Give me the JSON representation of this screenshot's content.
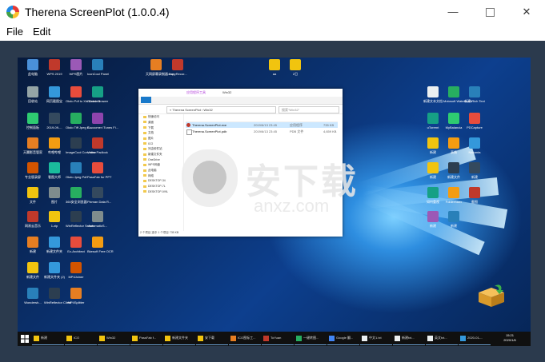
{
  "window": {
    "title": "Therena ScreenPlot (1.0.0.4)",
    "min_glyph": "—",
    "close_glyph": "✕"
  },
  "menu": {
    "file": "File",
    "edit": "Edit"
  },
  "desktop": {
    "icons": [
      {
        "label": "此电脑",
        "color": "#4a90d9"
      },
      {
        "label": "WPS 2019",
        "color": "#c0392b"
      },
      {
        "label": "WPS图片",
        "color": "#9b59b6"
      },
      {
        "label": "IconCool Panel",
        "color": "#2980b9"
      },
      {
        "label": "天网屏幕录制器.exe",
        "color": "#e67e22"
      },
      {
        "label": "CopyRecor...",
        "color": "#c0392b"
      },
      {
        "label": "aa",
        "color": "#f1c40f"
      },
      {
        "label": "2日",
        "color": "#f1c40f"
      },
      {
        "label": "回收站",
        "color": "#95a5a6"
      },
      {
        "label": "网页截图宝",
        "color": "#3498db"
      },
      {
        "label": "Okdo Pdf to Xls Convert",
        "color": "#e74c3c"
      },
      {
        "label": "Sketch Drawer",
        "color": "#16a085"
      },
      {
        "label": "控制面板",
        "color": "#2ecc71"
      },
      {
        "label": "2019-09-...",
        "color": "#34495e"
      },
      {
        "label": "Okdo Tiff Jpeg B...",
        "color": "#27ae60"
      },
      {
        "label": "Cococmer iTunes Fi...",
        "color": "#8e44ad"
      },
      {
        "label": "天翼影音管家",
        "color": "#e67e22"
      },
      {
        "label": "哔哩哔哩",
        "color": "#f39c12"
      },
      {
        "label": "ImageCool Converter",
        "color": "#2c3e50"
      },
      {
        "label": "Video Padlock",
        "color": "#c0392b"
      },
      {
        "label": "专业版录屏",
        "color": "#d35400"
      },
      {
        "label": "看图大师",
        "color": "#1abc9c"
      },
      {
        "label": "Okdo Jpeg Pdf",
        "color": "#2980b9"
      },
      {
        "label": "PassFab for PPT",
        "color": "#e74c3c"
      },
      {
        "label": "文件",
        "color": "#f1c40f"
      },
      {
        "label": "图片",
        "color": "#7f8c8d"
      },
      {
        "label": "360安全浏览器",
        "color": "#27ae60"
      },
      {
        "label": "Pixman Data R...",
        "color": "#34495e"
      },
      {
        "label": "网易云音乐",
        "color": "#c0392b"
      },
      {
        "label": "1.zip",
        "color": "#f1c40f"
      },
      {
        "label": "WinReflector Server",
        "color": "#2c3e50"
      },
      {
        "label": "AutomaticS...",
        "color": "#7f8c8d"
      },
      {
        "label": "新建",
        "color": "#e67e22"
      },
      {
        "label": "新建文件夹",
        "color": "#3498db"
      },
      {
        "label": "Ez-Architect",
        "color": "#e74c3c"
      },
      {
        "label": "Bkesoft Free OCR",
        "color": "#f39c12"
      },
      {
        "label": "新建文件",
        "color": "#f1c40f"
      },
      {
        "label": "新建文件夹 (2)",
        "color": "#3498db"
      },
      {
        "label": "MP4Joiner",
        "color": "#d35400"
      },
      {
        "label": "Wondersh...",
        "color": "#2980b9"
      },
      {
        "label": "WinReflector Client",
        "color": "#2c3e50"
      },
      {
        "label": "MP4Splitter",
        "color": "#e67e22"
      }
    ],
    "right_icons": [
      {
        "label": "新建文本文档",
        "color": "#ecf0f1"
      },
      {
        "label": "Motosoft Watermark",
        "color": "#27ae60"
      },
      {
        "label": "新建 Rich Text",
        "color": "#2980b9"
      },
      {
        "label": "uTorrent",
        "color": "#16a085"
      },
      {
        "label": "MyBalancia",
        "color": "#2ecc71"
      },
      {
        "label": "PDCapture",
        "color": "#e74c3c"
      },
      {
        "label": "新建",
        "color": "#f1c40f"
      },
      {
        "label": "表情",
        "color": "#f39c12"
      },
      {
        "label": "Nakanta",
        "color": "#3498db"
      },
      {
        "label": "新建",
        "color": "#f1c40f"
      },
      {
        "label": "新建文件",
        "color": "#2c3e50"
      },
      {
        "label": "新建",
        "color": "#34495e"
      },
      {
        "label": "如何重视",
        "color": "#16a085"
      },
      {
        "label": "FolderSizer",
        "color": "#f39c12"
      },
      {
        "label": "截图",
        "color": "#c0392b"
      },
      {
        "label": "新建",
        "color": "#9b59b6"
      },
      {
        "label": "新建",
        "color": "#2980b9"
      }
    ]
  },
  "explorer": {
    "title": "Win32",
    "ribbon_tab": "应用程序工具",
    "path": "« Therena ScreenPlot › Win32",
    "search": "搜索\"Win32\"",
    "nav": [
      "快速访问",
      "桌面",
      "下载",
      "文档",
      "图片",
      "ICO",
      "河由软件站",
      "新建文件夹",
      "OneDrive",
      "WPS网盘",
      "此电脑",
      "网络",
      "DESKTOP-34",
      "DESKTOP-7L",
      "DESKTOP-IV9L"
    ],
    "files": [
      {
        "name": "Therena.ScreenPlot.exe",
        "date": "2019/6/13 23:45",
        "type": "应用程序",
        "size": "735 KB"
      },
      {
        "name": "Therena.ScreenPlot.pdb",
        "date": "2019/6/13 23:45",
        "type": "PDB 文件",
        "size": "4,659 KB"
      }
    ],
    "status": "2 个项目  选中 1 个项目  735 KB"
  },
  "watermark": {
    "name": "安下载",
    "url": "anxz.com"
  },
  "taskbar": {
    "items": [
      {
        "label": "新建",
        "color": "#f1c40f"
      },
      {
        "label": "ICO",
        "color": "#f1c40f"
      },
      {
        "label": "Win32",
        "color": "#f1c40f"
      },
      {
        "label": "PassFab f...",
        "color": "#f1c40f"
      },
      {
        "label": "新建文件夹",
        "color": "#f1c40f"
      },
      {
        "label": "安下载",
        "color": "#f1c40f"
      },
      {
        "label": "ICO图标工...",
        "color": "#e67e22"
      },
      {
        "label": "ToYuan",
        "color": "#c0392b"
      },
      {
        "label": "一键转图...",
        "color": "#27ae60"
      },
      {
        "label": "Google 翻...",
        "color": "#4285f4"
      },
      {
        "label": "中文1.txt",
        "color": "#ecf0f1"
      },
      {
        "label": "新建txt...",
        "color": "#ecf0f1"
      },
      {
        "label": "英文txt...",
        "color": "#ecf0f1"
      },
      {
        "label": "2020-01-...",
        "color": "#3498db"
      }
    ],
    "clock_time": "15:21",
    "clock_date": "2020/1/6"
  }
}
